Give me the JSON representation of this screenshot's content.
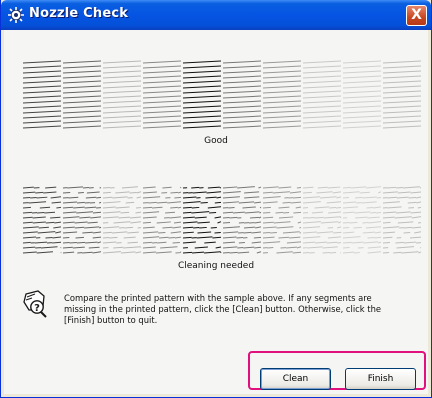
{
  "window": {
    "title": "Nozzle Check",
    "close_label": "X"
  },
  "patterns": [
    {
      "quality": "good",
      "caption": "Good"
    },
    {
      "quality": "damaged",
      "caption": "Cleaning needed"
    }
  ],
  "instructions": "Compare the printed pattern with the sample above. If any segments are missing in the printed pattern, click the [Clean] button. Otherwise, click the [Finish] button to quit.",
  "buttons": {
    "clean": "Clean",
    "finish": "Finish"
  },
  "colors": {
    "title_bar": "#0554e3",
    "highlight": "#e0107c",
    "button_border": "#003c74"
  },
  "icons": {
    "title": "printer-utility-icon",
    "help": "help-question-icon"
  }
}
